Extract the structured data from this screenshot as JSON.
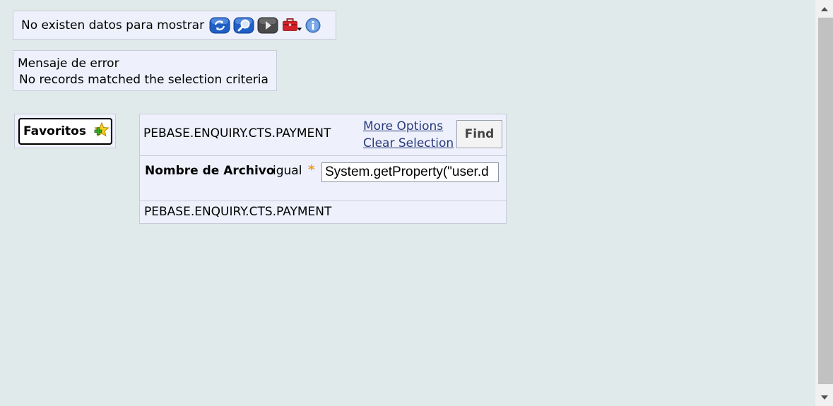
{
  "toolbar": {
    "message": "No existen datos para mostrar",
    "icons": [
      "refresh-icon",
      "search-icon",
      "play-icon",
      "toolbox-dropdown-icon",
      "info-icon"
    ],
    "colors": {
      "blue_icon": "#1f5fc6",
      "dark_icon": "#4a4a4a",
      "toolbox": "#d3202a",
      "info": "#5b8fd6"
    }
  },
  "error": {
    "title": "Mensaje de error",
    "text": "No records matched the selection criteria"
  },
  "favorites": {
    "label": "Favoritos",
    "icon": "add-favorite-star-icon"
  },
  "selection": {
    "enquiry_name": "PEBASE.ENQUIRY.CTS.PAYMENT",
    "more_options": "More Options",
    "clear_selection": "Clear Selection",
    "find": "Find",
    "field": {
      "label": "Nombre de Archivo",
      "operator": "igual",
      "required_mark": "*",
      "value": "System.getProperty(\"user.d"
    },
    "footer_name": "PEBASE.ENQUIRY.CTS.PAYMENT"
  },
  "colors": {
    "page_bg": "#e1eaea",
    "panel_bg": "#eef1fc",
    "link": "#2a3a7a",
    "required": "#f39a1b"
  }
}
